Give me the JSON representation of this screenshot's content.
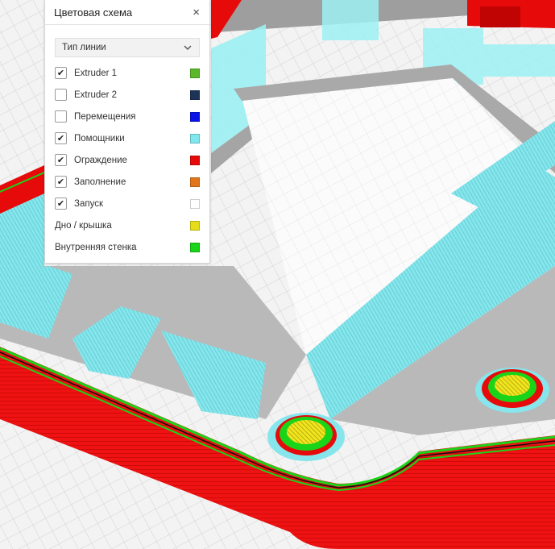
{
  "panel": {
    "title": "Цветовая схема",
    "close_glyph": "×",
    "dropdown": {
      "selected": "Тип линии"
    },
    "items": [
      {
        "label": "Extruder 1",
        "checkbox": true,
        "checked": true,
        "color": "#5ab82a"
      },
      {
        "label": "Extruder 2",
        "checkbox": true,
        "checked": false,
        "color": "#1e3358"
      },
      {
        "label": "Перемещения",
        "checkbox": true,
        "checked": false,
        "color": "#0a14e6"
      },
      {
        "label": "Помощники",
        "checkbox": true,
        "checked": true,
        "color": "#7fe8ef"
      },
      {
        "label": "Ограждение",
        "checkbox": true,
        "checked": true,
        "color": "#e60a0a"
      },
      {
        "label": "Заполнение",
        "checkbox": true,
        "checked": true,
        "color": "#e0771a"
      },
      {
        "label": "Запуск",
        "checkbox": true,
        "checked": true,
        "color": "#ffffff"
      },
      {
        "label": "Дно / крышка",
        "checkbox": false,
        "checked": false,
        "color": "#e6dc1a"
      },
      {
        "label": "Внутренняя стенка",
        "checkbox": false,
        "checked": false,
        "color": "#1ad41a"
      }
    ]
  },
  "colors": {
    "build_plate": "#f3f3f3",
    "grid_line": "#d2d2d2",
    "shell": "#e60a0a",
    "inner_wall": "#1ad41a",
    "support": "#7fe8ef",
    "infill_grey": "#b9b9b9",
    "top_bottom": "#e6dc1a"
  },
  "check_glyph": "✔"
}
